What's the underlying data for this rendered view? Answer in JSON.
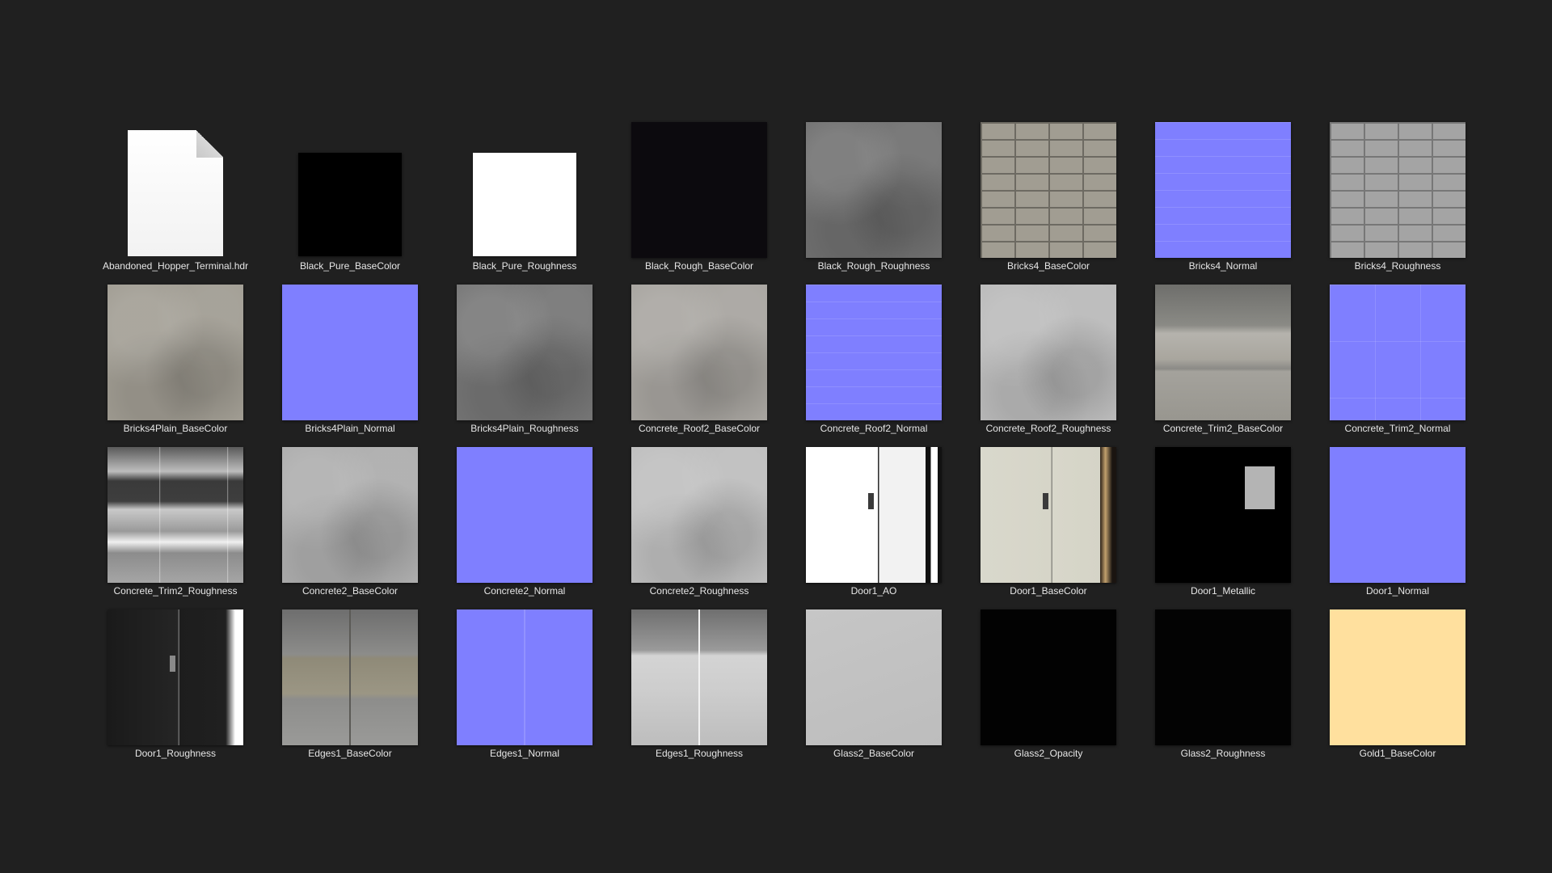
{
  "items": [
    {
      "name": "Abandoned_Hopper_Terminal.hdr",
      "kind": "file-icon"
    },
    {
      "name": "Black_Pure_BaseColor",
      "kind": "small",
      "color": "#000000"
    },
    {
      "name": "Black_Pure_Roughness",
      "kind": "small",
      "color": "#ffffff"
    },
    {
      "name": "Black_Rough_BaseColor",
      "kind": "solid",
      "color": "#0c0a0e"
    },
    {
      "name": "Black_Rough_Roughness",
      "kind": "noise",
      "color": "#6f6f6f"
    },
    {
      "name": "Bricks4_BaseColor",
      "kind": "bricks",
      "color": "#a19d92"
    },
    {
      "name": "Bricks4_Normal",
      "kind": "normal-lines",
      "color": "#7f7fff"
    },
    {
      "name": "Bricks4_Roughness",
      "kind": "bricks-rough",
      "color": "#a4a4a4"
    },
    {
      "name": "Bricks4Plain_BaseColor",
      "kind": "noise",
      "color": "#9f9b91"
    },
    {
      "name": "Bricks4Plain_Normal",
      "kind": "solid",
      "color": "#7f7fff"
    },
    {
      "name": "Bricks4Plain_Roughness",
      "kind": "noise",
      "color": "#747474"
    },
    {
      "name": "Concrete_Roof2_BaseColor",
      "kind": "noise",
      "color": "#a6a39e"
    },
    {
      "name": "Concrete_Roof2_Normal",
      "kind": "normal-lines",
      "color": "#7f7fff"
    },
    {
      "name": "Concrete_Roof2_Roughness",
      "kind": "noise",
      "color": "#b9b9b9"
    },
    {
      "name": "Concrete_Trim2_BaseColor",
      "kind": "trim",
      "color": "#999893"
    },
    {
      "name": "Concrete_Trim2_Normal",
      "kind": "normal-grid",
      "color": "#7f7fff"
    },
    {
      "name": "Concrete_Trim2_Roughness",
      "kind": "trim-rough",
      "color": "#888888"
    },
    {
      "name": "Concrete2_BaseColor",
      "kind": "noise",
      "color": "#acacac"
    },
    {
      "name": "Concrete2_Normal",
      "kind": "solid",
      "color": "#7f7fff"
    },
    {
      "name": "Concrete2_Roughness",
      "kind": "noise",
      "color": "#bdbdbd"
    },
    {
      "name": "Door1_AO",
      "kind": "door-ao",
      "color": "#ffffff"
    },
    {
      "name": "Door1_BaseColor",
      "kind": "door-base",
      "color": "#d6d5c8"
    },
    {
      "name": "Door1_Metallic",
      "kind": "door-metal",
      "color": "#000000"
    },
    {
      "name": "Door1_Normal",
      "kind": "solid",
      "color": "#7f7fff"
    },
    {
      "name": "Door1_Roughness",
      "kind": "door-rough",
      "color": "#222222"
    },
    {
      "name": "Edges1_BaseColor",
      "kind": "edges",
      "color": "#8c8b86"
    },
    {
      "name": "Edges1_Normal",
      "kind": "edges-normal",
      "color": "#7f7fff"
    },
    {
      "name": "Edges1_Roughness",
      "kind": "edges-rough",
      "color": "#b5b5b5"
    },
    {
      "name": "Glass2_BaseColor",
      "kind": "glass",
      "color": "#c3c3c3"
    },
    {
      "name": "Glass2_Opacity",
      "kind": "solid",
      "color": "#020202"
    },
    {
      "name": "Glass2_Roughness",
      "kind": "solid",
      "color": "#030303"
    },
    {
      "name": "Gold1_BaseColor",
      "kind": "solid",
      "color": "#ffe09e"
    }
  ]
}
